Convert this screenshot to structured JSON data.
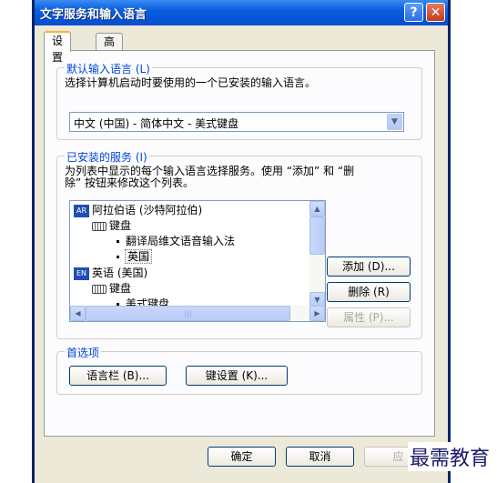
{
  "window": {
    "title": "文字服务和输入语言",
    "help": "?",
    "close": "✕"
  },
  "tabs": [
    {
      "label": "设置"
    },
    {
      "label": "高级"
    }
  ],
  "default_lang": {
    "title": "默认输入语言 (L)",
    "description": "选择计算机启动时要使用的一个已安装的输入语言。",
    "selected": "中文 (中国) - 简体中文 - 美式键盘"
  },
  "services": {
    "title": "已安装的服务 (I)",
    "description_line1": "为列表中显示的每个输入语言选择服务。使用 “添加” 和 “删",
    "description_line2": "除” 按钮来修改这个列表。",
    "tree": {
      "ar_badge": "AR",
      "ar_lang": "阿拉伯语 (沙特阿拉伯)",
      "ar_keyboard": "键盘",
      "ar_item1": "翻译局维文语音输入法",
      "ar_item2": "英国",
      "en_badge": "EN",
      "en_lang": "英语 (美国)",
      "en_keyboard": "键盘",
      "en_item1": "美式键盘"
    },
    "add": "添加 (D)...",
    "remove": "删除 (R)",
    "properties": "属性 (P)..."
  },
  "prefs": {
    "title": "首选项",
    "language_bar": "语言栏 (B)...",
    "key_settings": "键设置 (K)..."
  },
  "footer": {
    "ok": "确定",
    "cancel": "取消",
    "apply": "应"
  },
  "watermark": "最需教育"
}
